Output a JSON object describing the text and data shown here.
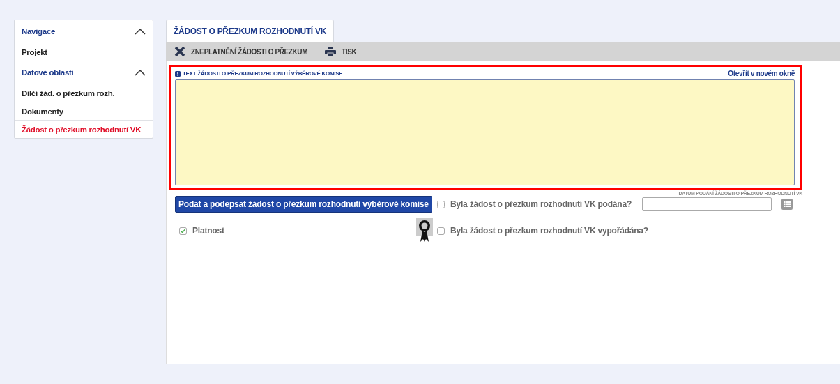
{
  "sidebar": {
    "items": [
      {
        "label": "Navigace",
        "kind": "header",
        "expanded": true
      },
      {
        "label": "Projekt",
        "kind": "item",
        "selected": false
      },
      {
        "label": "Datové oblasti",
        "kind": "header",
        "expanded": true
      },
      {
        "label": "Dílčí žád. o přezkum rozh.",
        "kind": "item",
        "selected": false
      },
      {
        "label": "Dokumenty",
        "kind": "item",
        "selected": false
      },
      {
        "label": "Žádost o přezkum rozhodnutí VK",
        "kind": "item",
        "selected": true
      }
    ]
  },
  "tab": {
    "label": "ŽÁDOST O PŘEZKUM ROZHODNUTÍ VK",
    "selected": true
  },
  "toolbar": [
    {
      "label": "ZNEPLATNĚNÍ ŽÁDOSTI O PŘEZKUM",
      "kind": "cancel"
    },
    {
      "label": "TISK",
      "kind": "print"
    }
  ],
  "text_field": {
    "label": "TEXT ŽÁDOSTI O PŘEZKUM ROZHODNUTÍ VÝBĚROVÉ KOMISE",
    "link": "Otevřít v novém okně"
  },
  "submit_button": "Podat a podepsat žádost o přezkum rozhodnutí výběrové komise",
  "platnost": {
    "label": "Platnost",
    "checked": true
  },
  "submitted": {
    "label": "Byla žádost o přezkum rozhodnutí VK podána?",
    "checked": false
  },
  "settled": {
    "label": "Byla žádost o přezkum rozhodnutí VK vypořádána?",
    "checked": false
  },
  "date_field": {
    "label": "DATUM PODÁNÍ ŽÁDOSTI O PŘEZKUM ROZHODNUTÍ VK"
  }
}
